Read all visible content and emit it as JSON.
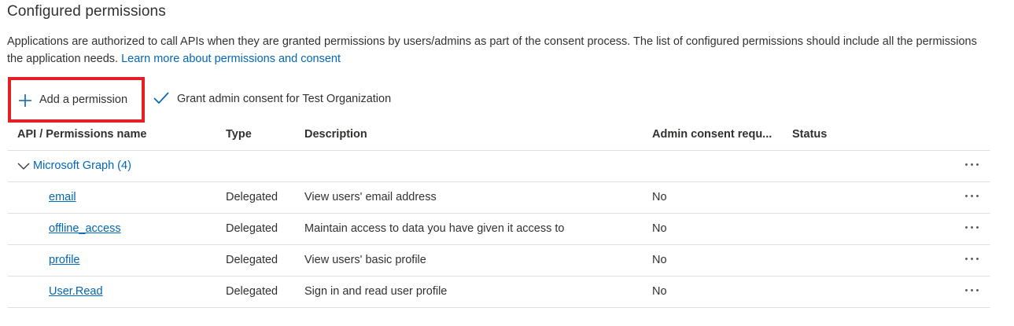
{
  "section": {
    "title": "Configured permissions",
    "description": "Applications are authorized to call APIs when they are granted permissions by users/admins as part of the consent process. The list of configured permissions should include all the permissions the application needs.",
    "learn_more": "Learn more about permissions and consent"
  },
  "toolbar": {
    "add_label": "Add a permission",
    "grant_label": "Grant admin consent for Test Organization"
  },
  "table": {
    "headers": {
      "name": "API / Permissions name",
      "type": "Type",
      "description": "Description",
      "admin": "Admin consent requ...",
      "status": "Status"
    },
    "group": {
      "label": "Microsoft Graph (4)"
    },
    "rows": [
      {
        "name": "email",
        "type": "Delegated",
        "description": "View users' email address",
        "admin": "No",
        "status": ""
      },
      {
        "name": "offline_access",
        "type": "Delegated",
        "description": "Maintain access to data you have given it access to",
        "admin": "No",
        "status": ""
      },
      {
        "name": "profile",
        "type": "Delegated",
        "description": "View users' basic profile",
        "admin": "No",
        "status": ""
      },
      {
        "name": "User.Read",
        "type": "Delegated",
        "description": "Sign in and read user profile",
        "admin": "No",
        "status": ""
      }
    ]
  },
  "colors": {
    "link": "#0067b8",
    "highlight_border": "#e32026",
    "text": "#323130",
    "divider": "#e1dfdd"
  },
  "icons": {
    "add": "plus-icon",
    "grant": "checkmark-icon",
    "group_toggle": "chevron-down-icon",
    "row_menu": "more-icon"
  }
}
